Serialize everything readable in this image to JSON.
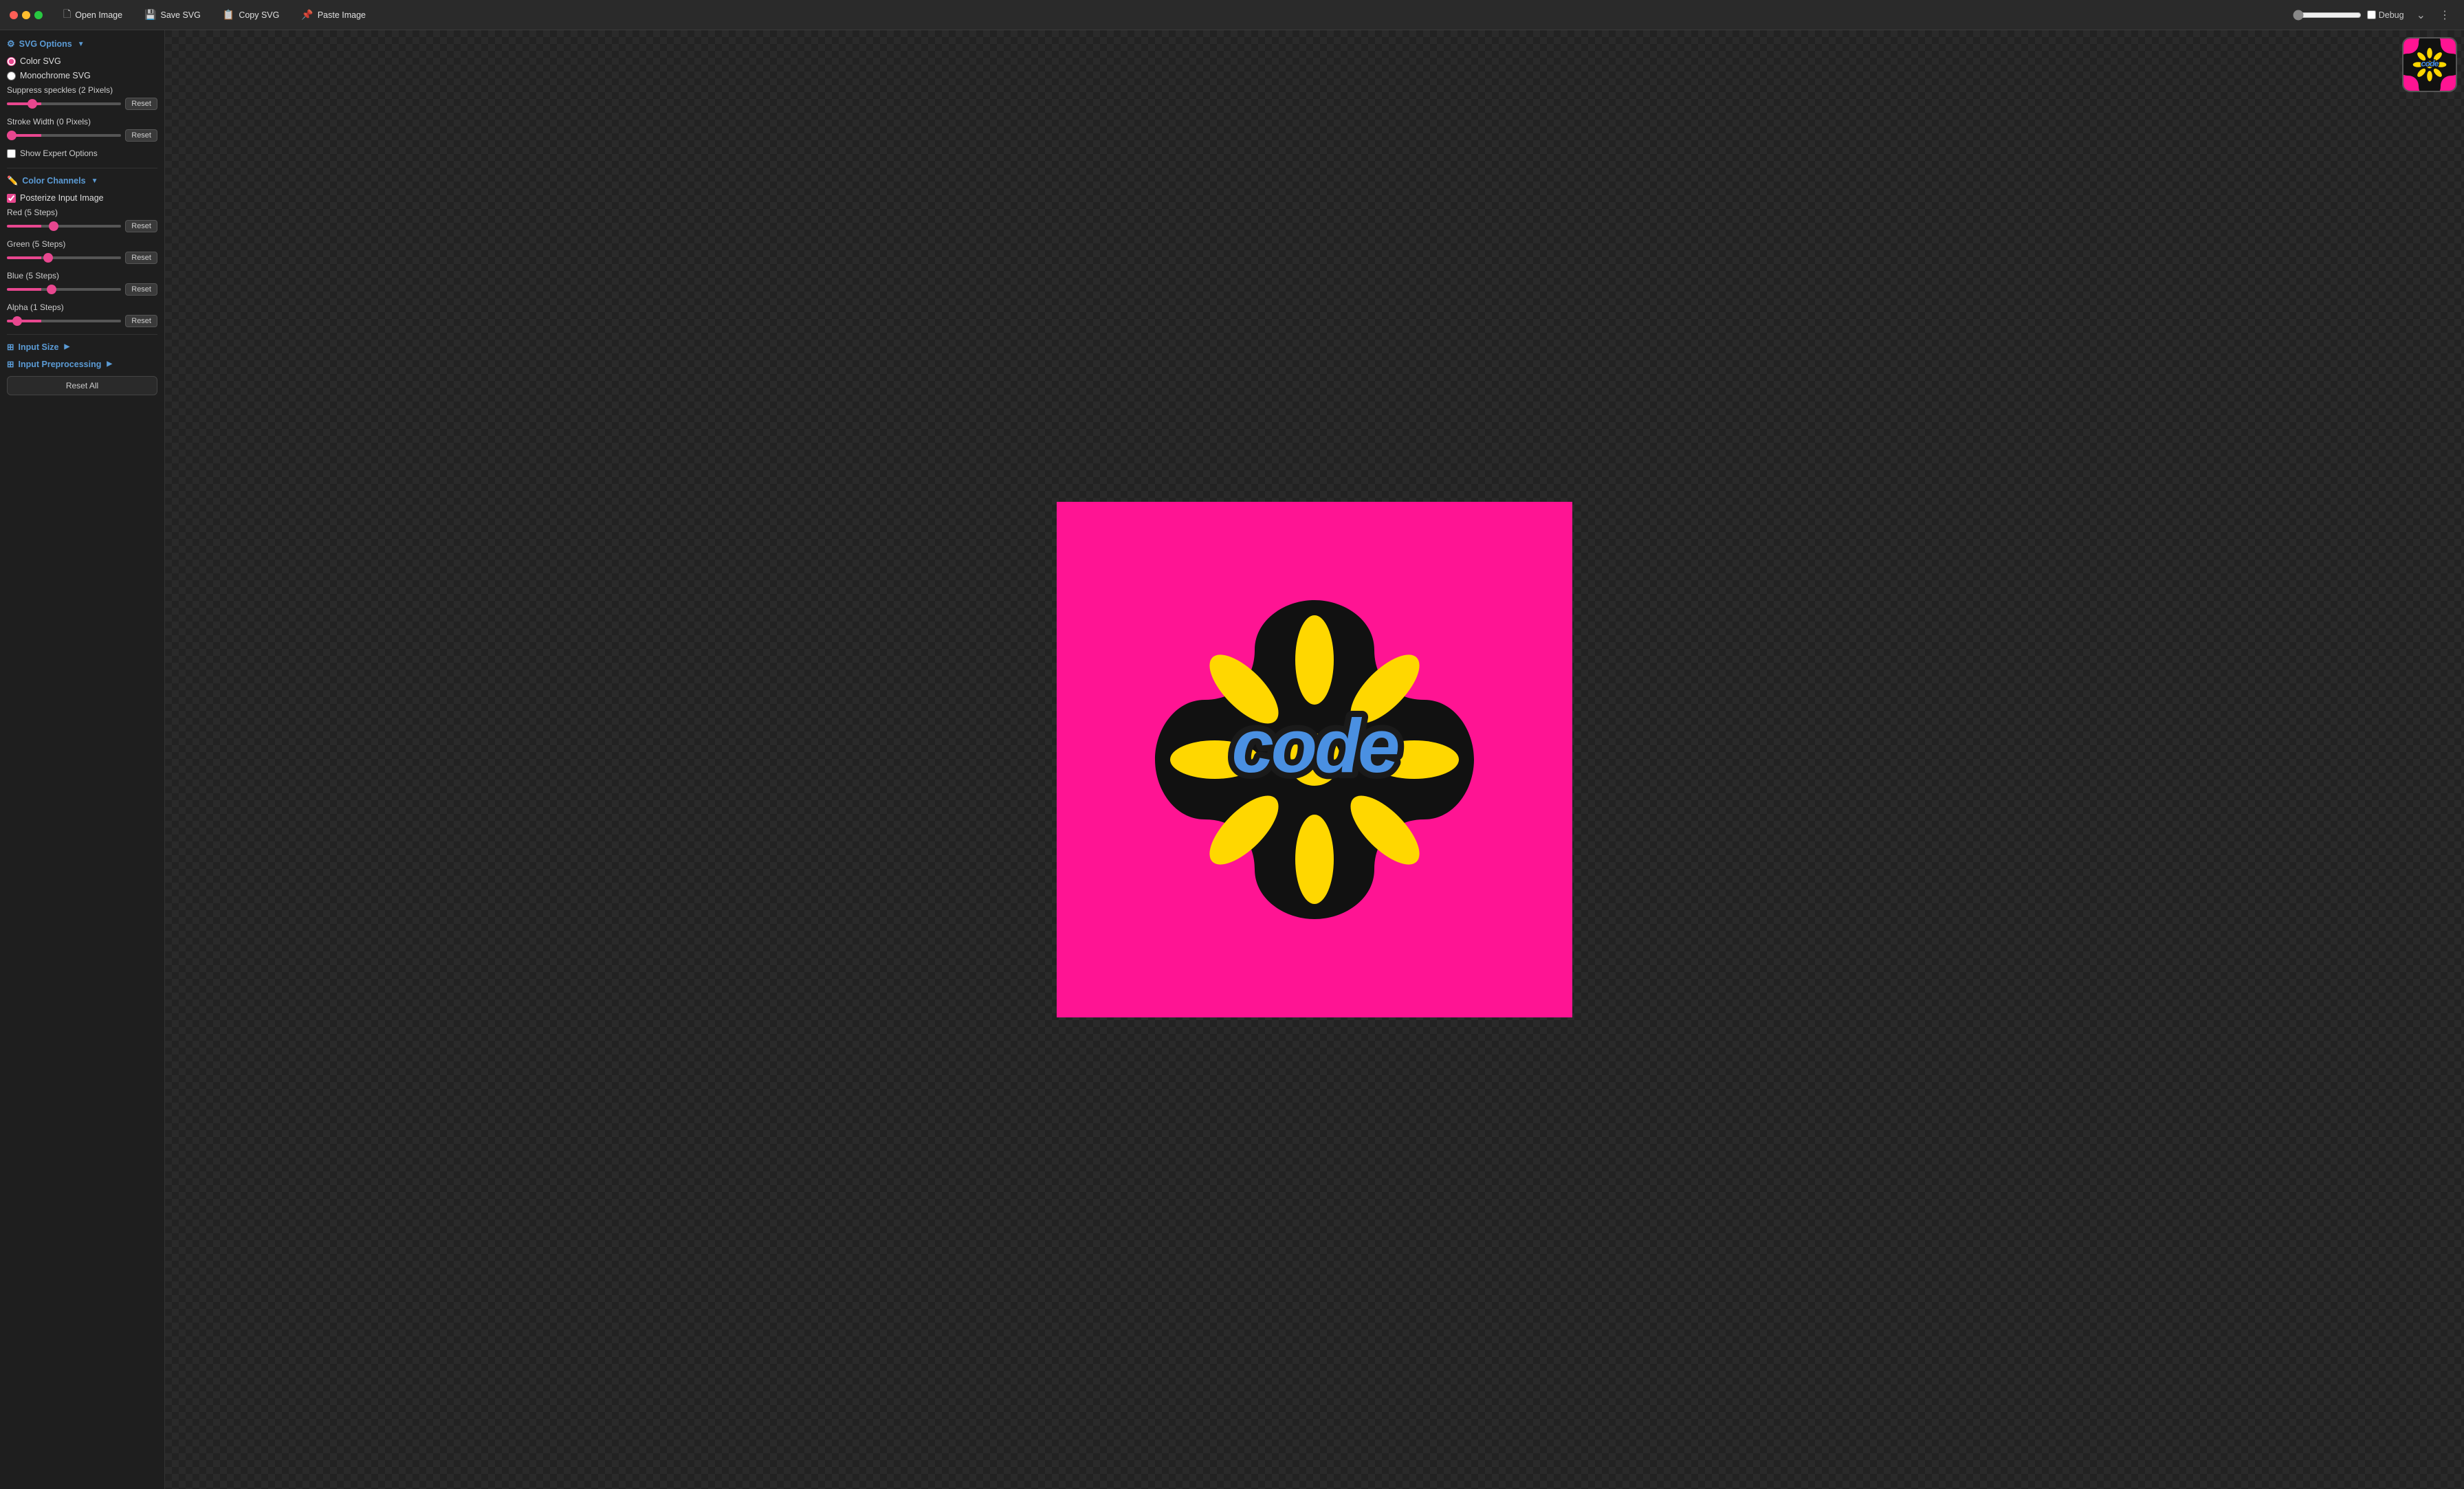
{
  "titlebar": {
    "open_image_label": "Open Image",
    "save_svg_label": "Save SVG",
    "copy_svg_label": "Copy SVG",
    "paste_image_label": "Paste Image",
    "debug_label": "Debug"
  },
  "sidebar": {
    "svg_options_label": "SVG Options",
    "color_svg_label": "Color SVG",
    "monochrome_svg_label": "Monochrome SVG",
    "suppress_speckles_label": "Suppress speckles (2 Pixels)",
    "stroke_width_label": "Stroke Width (0 Pixels)",
    "show_expert_label": "Show Expert Options",
    "color_channels_label": "Color Channels",
    "posterize_label": "Posterize Input Image",
    "red_label": "Red (5 Steps)",
    "green_label": "Green (5 Steps)",
    "blue_label": "Blue (5 Steps)",
    "alpha_label": "Alpha (1 Steps)",
    "reset_label": "Reset",
    "input_size_label": "Input Size",
    "input_preprocessing_label": "Input Preprocessing",
    "reset_all_label": "Reset All"
  },
  "colors": {
    "accent_blue": "#5b9bd5",
    "accent_pink": "#e8478f",
    "bg_dark": "#1e1e1e",
    "slider_thumb": "#e8478f"
  }
}
